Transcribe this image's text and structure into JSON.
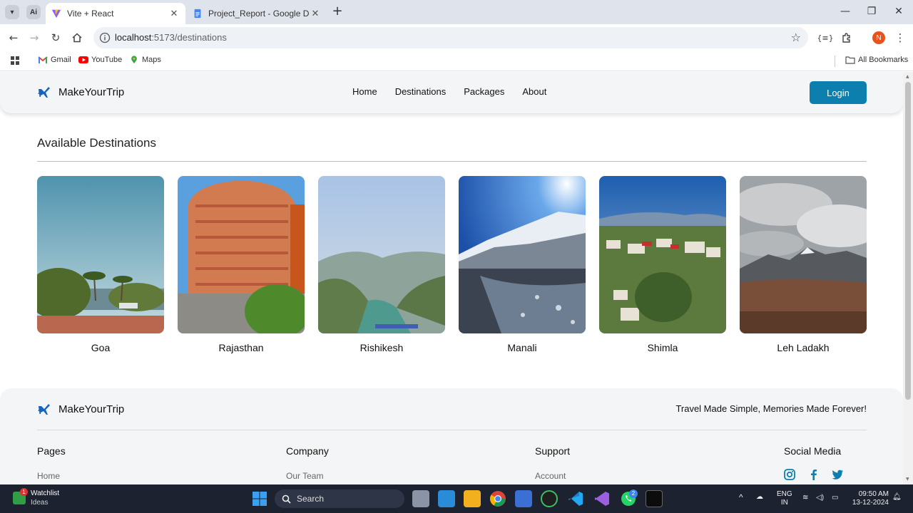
{
  "browser": {
    "tabs": [
      {
        "title": "Vite + React",
        "active": true
      },
      {
        "title": "Project_Report - Google Docs",
        "active": false
      }
    ],
    "url_host": "localhost",
    "url_path": ":5173/destinations",
    "profile_initial": "N",
    "bookmarks": [
      "Gmail",
      "YouTube",
      "Maps"
    ],
    "all_bookmarks": "All Bookmarks"
  },
  "site": {
    "brand": "MakeYourTrip",
    "nav": [
      "Home",
      "Destinations",
      "Packages",
      "About"
    ],
    "login_label": "Login",
    "section_title": "Available Destinations",
    "destinations": [
      {
        "name": "Goa"
      },
      {
        "name": "Rajasthan"
      },
      {
        "name": "Rishikesh"
      },
      {
        "name": "Manali"
      },
      {
        "name": "Shimla"
      },
      {
        "name": "Leh Ladakh"
      }
    ],
    "footer": {
      "brand": "MakeYourTrip",
      "tagline": "Travel Made Simple, Memories Made Forever!",
      "columns": [
        {
          "title": "Pages",
          "first_link": "Home"
        },
        {
          "title": "Company",
          "first_link": "Our Team"
        },
        {
          "title": "Support",
          "first_link": "Account"
        },
        {
          "title": "Social Media"
        }
      ],
      "social_icons": [
        "instagram-icon",
        "facebook-icon",
        "twitter-icon"
      ]
    }
  },
  "taskbar": {
    "widget_title": "Watchlist",
    "widget_sub": "Ideas",
    "widget_badge": "1",
    "search_label": "Search",
    "lang_top": "ENG",
    "lang_bottom": "IN",
    "time": "09:50 AM",
    "date": "13-12-2024",
    "whatsapp_badge": "2"
  },
  "colors": {
    "accent": "#0c7fae",
    "navbar_bg": "#f4f5f6",
    "taskbar_bg": "#1c2230"
  }
}
